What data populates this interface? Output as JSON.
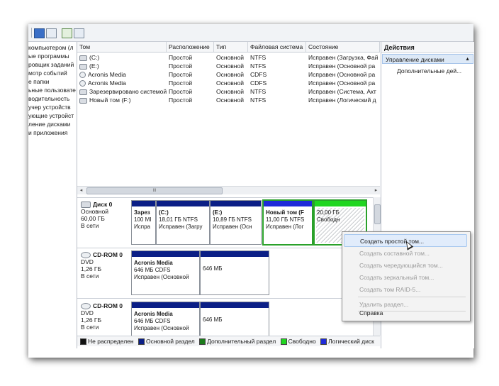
{
  "toolbar": {
    "icons": [
      "help-icon",
      "console-icon",
      "refresh-icon",
      "properties-icon"
    ]
  },
  "nav": {
    "items": [
      "компьютером (л",
      "ые программы",
      "ровщик заданий",
      "мотр событий",
      "е папки",
      "ьные пользовате",
      "водительность",
      "учер устройств",
      "ующие устройст",
      "ление дисками",
      "и приложения"
    ]
  },
  "volumes": {
    "columns": [
      "Том",
      "Расположение",
      "Тип",
      "Файловая система",
      "Состояние"
    ],
    "rows": [
      {
        "name": "(C:)",
        "icon": "disk",
        "layout": "Простой",
        "type": "Основной",
        "fs": "NTFS",
        "status": "Исправен (Загрузка, Фай"
      },
      {
        "name": "(E:)",
        "icon": "disk",
        "layout": "Простой",
        "type": "Основной",
        "fs": "NTFS",
        "status": "Исправен (Основной ра"
      },
      {
        "name": "Acronis Media",
        "icon": "cd",
        "layout": "Простой",
        "type": "Основной",
        "fs": "CDFS",
        "status": "Исправен (Основной ра"
      },
      {
        "name": "Acronis Media",
        "icon": "cd",
        "layout": "Простой",
        "type": "Основной",
        "fs": "CDFS",
        "status": "Исправен (Основной ра"
      },
      {
        "name": "Зарезервировано системой",
        "icon": "disk",
        "layout": "Простой",
        "type": "Основной",
        "fs": "NTFS",
        "status": "Исправен (Система, Акт"
      },
      {
        "name": "Новый том (F:)",
        "icon": "disk",
        "layout": "Простой",
        "type": "Основной",
        "fs": "NTFS",
        "status": "Исправен (Логический д"
      }
    ],
    "scroll_thumb_label": "III"
  },
  "disks": [
    {
      "name": "Диск 0",
      "type": "Основной",
      "size": "60,00 ГБ",
      "state": "В сети",
      "parts": [
        {
          "l1": "Зарез",
          "l2": "100 МІ",
          "l3": "Испра"
        },
        {
          "l1": "(C:)",
          "l2": "18,01 ГБ NTFS",
          "l3": "Исправен (Загру"
        },
        {
          "l1": "(E:)",
          "l2": "10,89 ГБ NTFS",
          "l3": "Исправен (Осн"
        },
        {
          "l1": "Новый том (F",
          "l2": "11,00 ГБ NTFS",
          "l3": "Исправен (Лог"
        },
        {
          "l1": "",
          "l2": "20,00 ГБ",
          "l3": "Свободн"
        }
      ]
    },
    {
      "name": "CD-ROM 0",
      "type": "DVD",
      "size": "1,26 ГБ",
      "state": "В сети",
      "parts": [
        {
          "l1": "Acronis Media",
          "l2": "646 МБ CDFS",
          "l3": "Исправен (Основной"
        },
        {
          "l1": "646 МБ",
          "l2": "",
          "l3": ""
        }
      ]
    },
    {
      "name": "CD-ROM 0",
      "type": "DVD",
      "size": "1,26 ГБ",
      "state": "В сети",
      "parts": [
        {
          "l1": "Acronis Media",
          "l2": "646 МБ CDFS",
          "l3": "Исправен (Основной"
        },
        {
          "l1": "646 МБ",
          "l2": "",
          "l3": ""
        }
      ]
    }
  ],
  "legend": [
    {
      "label": "Не распределен",
      "color": "#111111"
    },
    {
      "label": "Основной раздел",
      "color": "#0b1f86"
    },
    {
      "label": "Дополнительный раздел",
      "color": "#1a7a1a"
    },
    {
      "label": "Свободно",
      "color": "#20d620"
    },
    {
      "label": "Логический диск",
      "color": "#1f2bd9"
    }
  ],
  "actions": {
    "title": "Действия",
    "selected": "Управление дисками",
    "sub": "Дополнительные дей..."
  },
  "context_menu": {
    "items": [
      {
        "label": "Создать простой том...",
        "enabled": true,
        "hover": true
      },
      {
        "label": "Создать составной том...",
        "enabled": false
      },
      {
        "label": "Создать чередующийся том...",
        "enabled": false
      },
      {
        "label": "Создать зеркальный том...",
        "enabled": false
      },
      {
        "label": "Создать том RAID-5...",
        "enabled": false
      },
      {
        "label": "Удалить раздел...",
        "enabled": false
      },
      {
        "label": "Справка",
        "enabled": true
      }
    ]
  }
}
